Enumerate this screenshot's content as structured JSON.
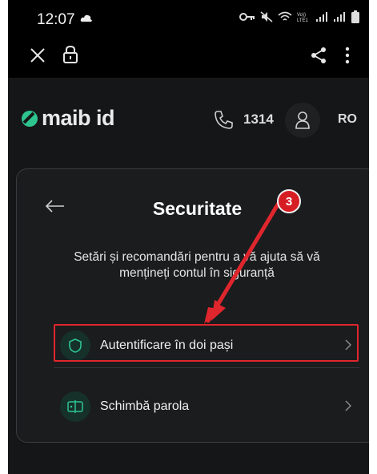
{
  "status_bar": {
    "time": "12:07"
  },
  "header": {
    "brand": "maib id",
    "phone_number": "1314",
    "language": "RO"
  },
  "page": {
    "title": "Securitate",
    "subtitle": "Setări și recomandări pentru a vă ajuta să vă mențineți contul în siguranță"
  },
  "menu": {
    "items": [
      {
        "label": "Autentificare în doi pași",
        "icon": "shield-icon"
      },
      {
        "label": "Schimbă parola",
        "icon": "password-icon"
      }
    ]
  },
  "annotation": {
    "step": "3",
    "color": "#e0262d"
  },
  "colors": {
    "accent": "#2ec48f",
    "background": "#151617",
    "card": "#1b1c1e"
  }
}
